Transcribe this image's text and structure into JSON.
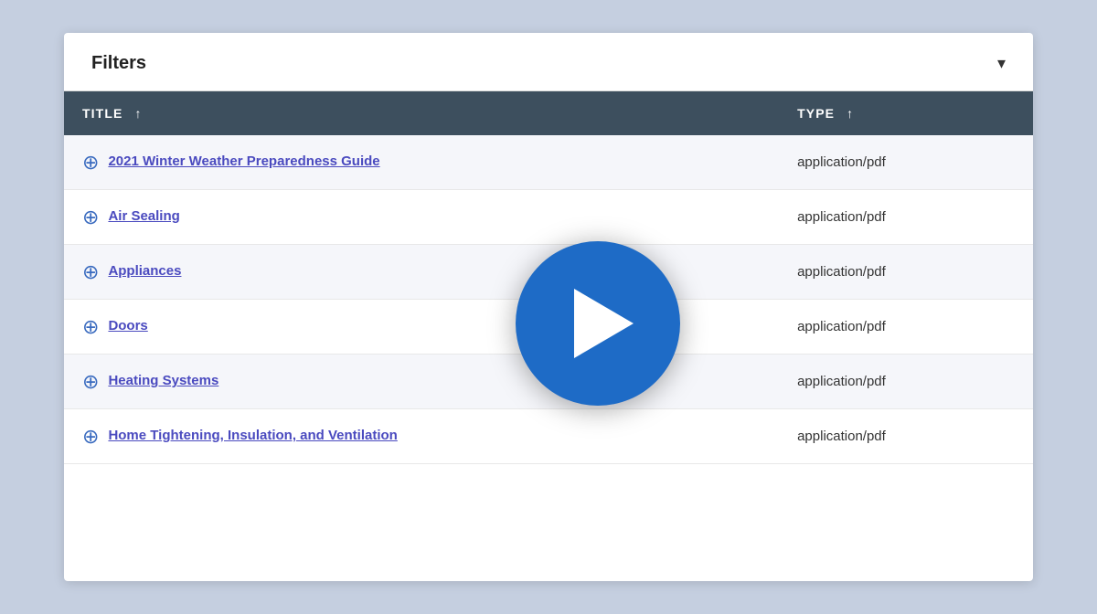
{
  "filters": {
    "label": "Filters",
    "chevron": "▾"
  },
  "table": {
    "columns": [
      {
        "key": "title",
        "label": "TITLE",
        "sort": "↑"
      },
      {
        "key": "type",
        "label": "TYPE",
        "sort": "↑"
      }
    ],
    "rows": [
      {
        "id": 1,
        "title": "2021 Winter Weather Preparedness Guide",
        "type": "application/pdf",
        "odd": true
      },
      {
        "id": 2,
        "title": "Air Sealing",
        "type": "application/pdf",
        "odd": false
      },
      {
        "id": 3,
        "title": "Appliances",
        "type": "application/pdf",
        "odd": true
      },
      {
        "id": 4,
        "title": "Doors",
        "type": "application/pdf",
        "odd": false
      },
      {
        "id": 5,
        "title": "Heating Systems",
        "type": "application/pdf",
        "odd": true
      },
      {
        "id": 6,
        "title": "Home Tightening, Insulation, and Ventilation",
        "type": "application/pdf",
        "odd": false
      }
    ]
  },
  "play_button": {
    "aria_label": "Play video"
  }
}
